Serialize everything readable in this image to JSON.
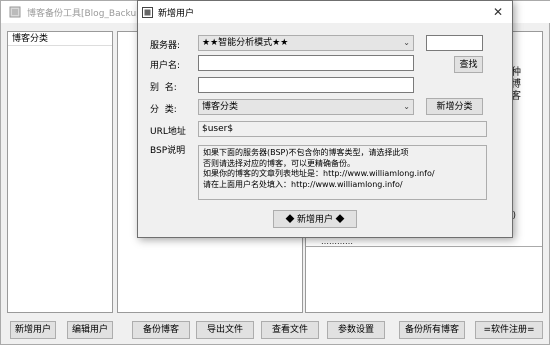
{
  "main_window": {
    "title": "博客备份工具[Blog_Backup]"
  },
  "left_panel": {
    "header": "博客分类"
  },
  "right_panel_peek": {
    "chars": "种\n博\n客",
    "paren": "))",
    "bottom_fragment": "…………"
  },
  "bottom_buttons": [
    {
      "label": "新增用户"
    },
    {
      "label": "编辑用户"
    },
    {
      "label": "备份博客"
    },
    {
      "label": "导出文件"
    },
    {
      "label": "查看文件"
    },
    {
      "label": "参数设置"
    },
    {
      "label": "备份所有博客"
    },
    {
      "label": "=软件注册="
    }
  ],
  "dialog": {
    "title": "新增用户",
    "close_label": "✕",
    "server_label": "服务器:",
    "server_value": "★★智能分析模式★★",
    "extra_input_value": "",
    "search_button": "查找",
    "username_label": "用户名:",
    "username_value": "",
    "alias_label": "别  名:",
    "alias_value": "",
    "category_label": "分  类:",
    "category_value": "博客分类",
    "add_category_button": "新增分类",
    "url_label": "URL地址",
    "url_value": "$user$",
    "bsp_label": "BSP说明",
    "bsp_lines": [
      "如果下面的服务器(BSP)不包含你的博客类型，请选择此项",
      "否则请选择对应的博客，可以更精确备份。",
      "如果你的博客的文章列表地址是：http://www.williamlong.info/",
      "请在上面用户名处填入：http://www.williamlong.info/"
    ],
    "submit_button": "◆  新增用户  ◆"
  }
}
